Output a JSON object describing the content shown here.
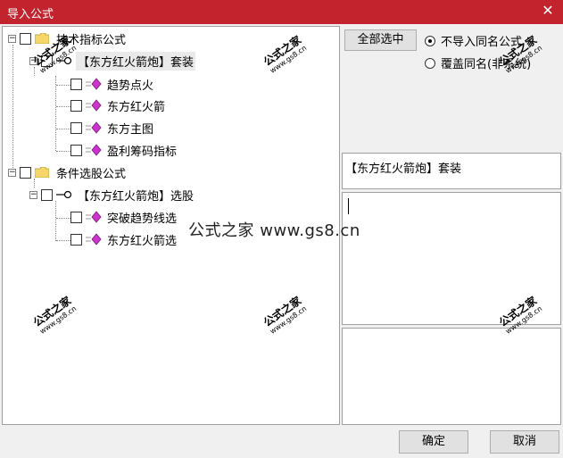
{
  "window": {
    "title": "导入公式",
    "close_glyph": "✕"
  },
  "tree": {
    "groups": [
      {
        "label": "技术指标公式",
        "children": [
          {
            "label": "【东方红火箭炮】套装",
            "items": [
              "趋势点火",
              "东方红火箭",
              "东方主图",
              "盈利筹码指标"
            ]
          }
        ]
      },
      {
        "label": "条件选股公式",
        "children": [
          {
            "label": "【东方红火箭炮】选股",
            "items": [
              "突破趋势线选",
              "东方红火箭选"
            ]
          }
        ]
      }
    ]
  },
  "options": {
    "select_all": "全部选中",
    "radio_skip": "不导入同名公式",
    "radio_overwrite": "覆盖同名(非系统)"
  },
  "info": {
    "selected_name": "【东方红火箭炮】套装",
    "description": "",
    "notes": ""
  },
  "footer": {
    "ok": "确定",
    "cancel": "取消"
  },
  "watermark": {
    "text": "公式之家",
    "url": "www.gs8.cn",
    "center": "公式之家 www.gs8.cn"
  },
  "colors": {
    "titlebar": "#c2232d",
    "item_icon": "#cc33cc"
  }
}
